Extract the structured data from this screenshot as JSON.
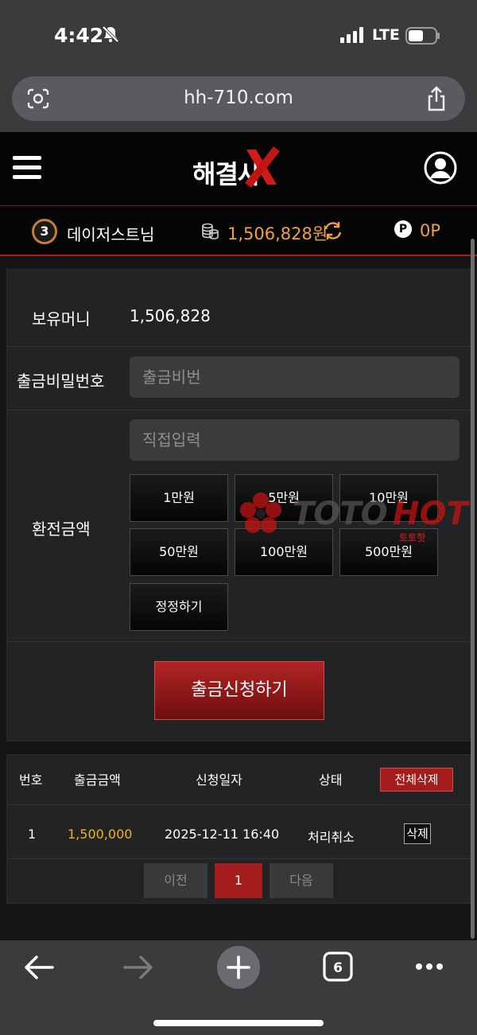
{
  "status_bar": {
    "time": "4:42",
    "network": "LTE"
  },
  "browser": {
    "url": "hh-710.com",
    "tab_count": "6"
  },
  "site": {
    "logo_text": "해결사"
  },
  "user_info": {
    "level": "3",
    "username": "데이저스트님",
    "balance": "1,506,828원",
    "points": "0P",
    "point_symbol": "P"
  },
  "form": {
    "balance_label": "보유머니",
    "balance_value": "1,506,828",
    "password_label": "출금비밀번호",
    "password_placeholder": "출금비번",
    "amount_label": "환전금액",
    "amount_placeholder": "직접입력",
    "amount_buttons": [
      "1만원",
      "5만원",
      "10만원",
      "50만원",
      "100만원",
      "500만원"
    ],
    "reset_label": "정정하기",
    "submit_label": "출금신청하기"
  },
  "watermark": {
    "brand": "TOTO",
    "brand_accent": "HOT",
    "sub": "토토핫"
  },
  "history": {
    "headers": [
      "번호",
      "출금금액",
      "신청일자",
      "상태"
    ],
    "delete_all_label": "전체삭제",
    "rows": [
      {
        "no": "1",
        "amount": "1,500,000",
        "date": "2025-12-11 16:40",
        "status": "처리취소",
        "delete_label": "삭제"
      }
    ],
    "pagination": {
      "prev": "이전",
      "current": "1",
      "next": "다음"
    }
  },
  "colors": {
    "accent_red": "#a51c1c",
    "balance_orange": "#f2a23a",
    "amount_yellow": "#f2b21b"
  }
}
